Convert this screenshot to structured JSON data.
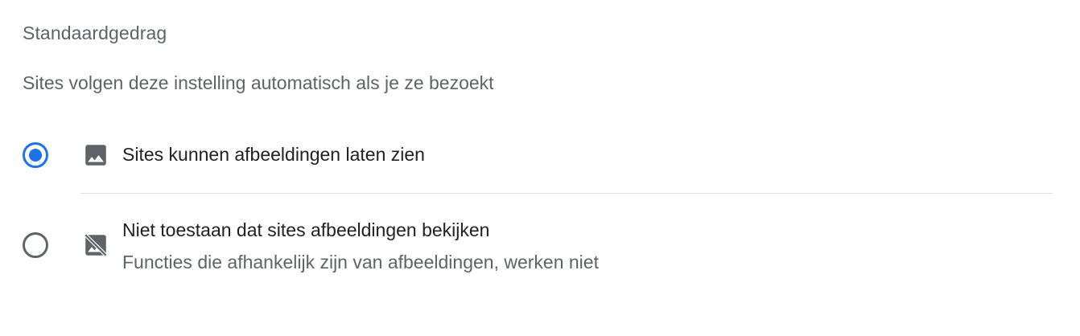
{
  "section": {
    "title": "Standaardgedrag",
    "description": "Sites volgen deze instelling automatisch als je ze bezoekt"
  },
  "options": [
    {
      "label": "Sites kunnen afbeeldingen laten zien",
      "sublabel": "",
      "icon": "image-icon",
      "selected": true
    },
    {
      "label": "Niet toestaan dat sites afbeeldingen bekijken",
      "sublabel": "Functies die afhankelijk zijn van afbeeldingen, werken niet",
      "icon": "image-blocked-icon",
      "selected": false
    }
  ],
  "colors": {
    "accent": "#1a73e8",
    "secondary_text": "#5f6368",
    "primary_text": "#202124",
    "divider": "#e0e0e0"
  }
}
